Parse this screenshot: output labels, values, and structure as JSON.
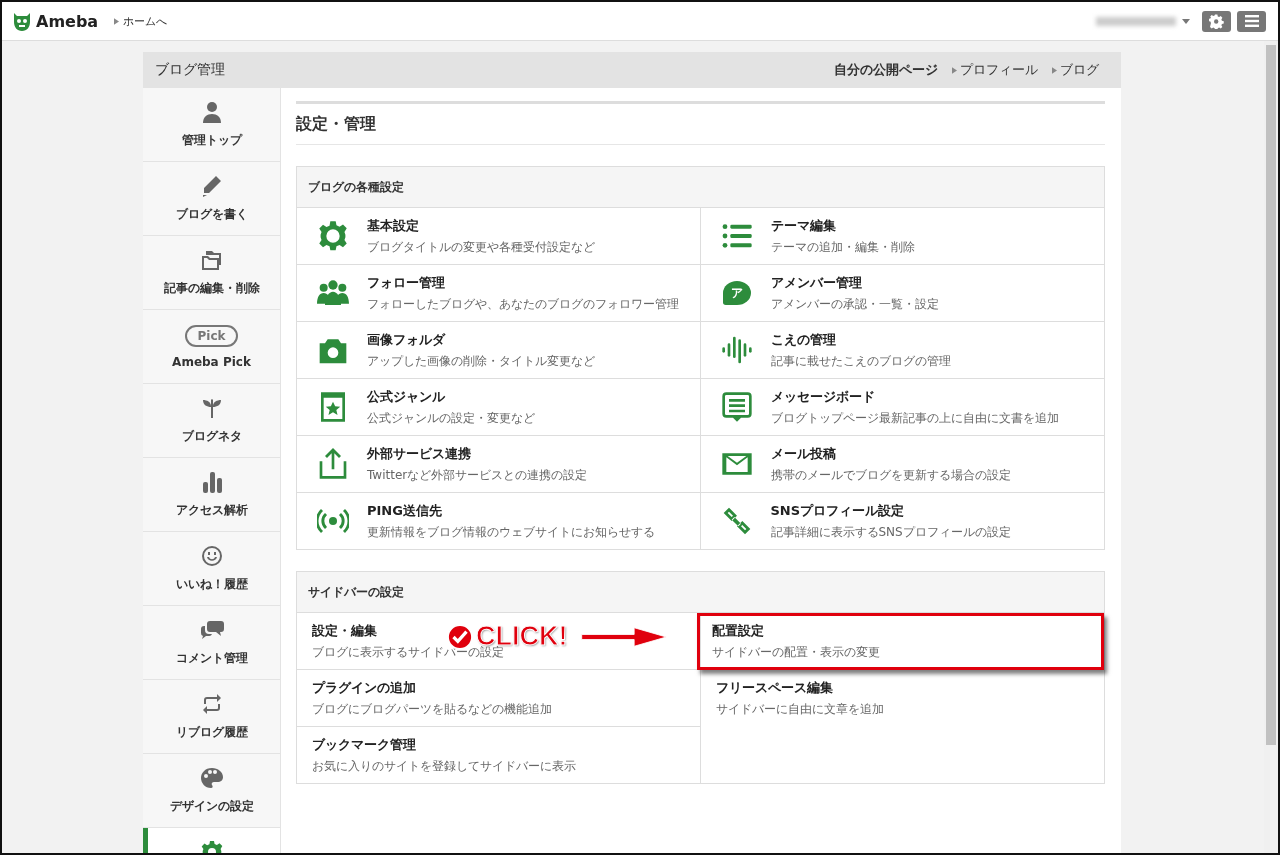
{
  "topbar": {
    "logo": "Ameba",
    "home_link": "ホームへ"
  },
  "panel": {
    "title": "ブログ管理",
    "links": [
      {
        "label": "自分の公開ページ",
        "arrow": false
      },
      {
        "label": "プロフィール",
        "arrow": true
      },
      {
        "label": "ブログ",
        "arrow": true
      }
    ]
  },
  "sidebar": {
    "items": [
      {
        "label": "管理トップ",
        "kind": "person",
        "selected": false
      },
      {
        "label": "ブログを書く",
        "kind": "pencil",
        "selected": false
      },
      {
        "label": "記事の編集・削除",
        "kind": "folders",
        "selected": false
      },
      {
        "label": "Ameba Pick",
        "kind": "pill",
        "icon_text": "Pick",
        "selected": false
      },
      {
        "label": "ブログネタ",
        "kind": "sprout",
        "selected": false
      },
      {
        "label": "アクセス解析",
        "kind": "bars",
        "selected": false
      },
      {
        "label": "いいね！履歴",
        "kind": "smile",
        "selected": false
      },
      {
        "label": "コメント管理",
        "kind": "chat",
        "selected": false
      },
      {
        "label": "リブログ履歴",
        "kind": "repost",
        "selected": false
      },
      {
        "label": "デザインの設定",
        "kind": "palette",
        "selected": false
      },
      {
        "kind": "gear",
        "selected": true
      }
    ]
  },
  "page_title": "設定・管理",
  "sections": [
    {
      "title": "ブログの各種設定",
      "items": [
        {
          "kind": "gear",
          "title": "基本設定",
          "desc": "ブログタイトルの変更や各種受付設定など"
        },
        {
          "kind": "list",
          "title": "テーマ編集",
          "desc": "テーマの追加・編集・削除"
        },
        {
          "kind": "people",
          "title": "フォロー管理",
          "desc": "フォローしたブログや、あなたのブログのフォロワー管理"
        },
        {
          "kind": "bubble",
          "icon_text": "ア",
          "title": "アメンバー管理",
          "desc": "アメンバーの承認・一覧・設定"
        },
        {
          "kind": "camera",
          "title": "画像フォルダ",
          "desc": "アップした画像の削除・タイトル変更など"
        },
        {
          "kind": "voice",
          "title": "こえの管理",
          "desc": "記事に載せたこえのブログの管理"
        },
        {
          "kind": "star",
          "title": "公式ジャンル",
          "desc": "公式ジャンルの設定・変更など"
        },
        {
          "kind": "board",
          "title": "メッセージボード",
          "desc": "ブログトップページ最新記事の上に自由に文書を追加"
        },
        {
          "kind": "upload",
          "title": "外部サービス連携",
          "desc": "Twitterなど外部サービスとの連携の設定"
        },
        {
          "kind": "mail",
          "title": "メール投稿",
          "desc": "携帯のメールでブログを更新する場合の設定"
        },
        {
          "kind": "signal",
          "title": "PING送信先",
          "desc": "更新情報をブログ情報のウェブサイトにお知らせする"
        },
        {
          "kind": "link",
          "title": "SNSプロフィール設定",
          "desc": "記事詳細に表示するSNSプロフィールの設定"
        }
      ]
    },
    {
      "title": "サイドバーの設定",
      "callout": "CLICK!",
      "items": [
        {
          "title": "設定・編集",
          "desc": "ブログに表示するサイドバーの設定",
          "highlighted": false
        },
        {
          "title": "配置設定",
          "desc": "サイドバーの配置・表示の変更",
          "highlighted": true
        },
        {
          "title": "プラグインの追加",
          "desc": "ブログにブログパーツを貼るなどの機能追加",
          "highlighted": false
        },
        {
          "title": "フリースペース編集",
          "desc": "サイドバーに自由に文章を追加",
          "highlighted": false
        },
        {
          "title": "ブックマーク管理",
          "desc": "お気に入りのサイトを登録してサイドバーに表示",
          "highlighted": false
        }
      ]
    }
  ]
}
